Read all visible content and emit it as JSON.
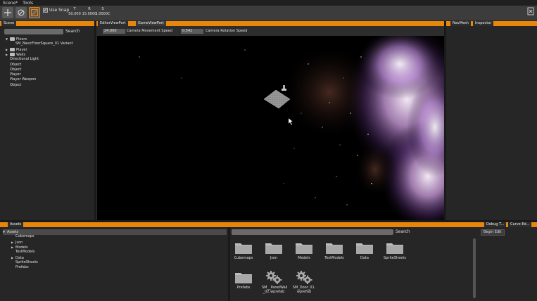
{
  "menu": {
    "items": [
      "Scene*",
      "Tools"
    ]
  },
  "toolbar": {
    "use_snap_label": "Use Snap",
    "snap_checked": true,
    "snap_columns": [
      {
        "header": "T",
        "value": "50.000"
      },
      {
        "header": "R",
        "value": "15.0000"
      },
      {
        "header": "S",
        "value": "1.0000C"
      }
    ],
    "buttons": [
      {
        "icon": "move-icon",
        "active": false
      },
      {
        "icon": "rotate-icon",
        "active": false
      },
      {
        "icon": "scale-icon",
        "active": true
      }
    ]
  },
  "scene_panel": {
    "tab": "Scene",
    "search_label": "Search",
    "tree": [
      {
        "label": "Floors",
        "depth": 0,
        "expanded": true,
        "folder": true
      },
      {
        "label": "SM_BasicFloorSquare_01 Variant",
        "depth": 1,
        "expanded": null,
        "folder": false
      },
      {
        "label": "Player",
        "depth": 0,
        "expanded": false,
        "folder": true
      },
      {
        "label": "Walls",
        "depth": 0,
        "expanded": false,
        "folder": true
      },
      {
        "label": "Directional Light",
        "depth": 0,
        "expanded": null,
        "folder": false
      },
      {
        "label": "Object",
        "depth": 0,
        "expanded": null,
        "folder": false
      },
      {
        "label": "Object",
        "depth": 0,
        "expanded": null,
        "folder": false
      },
      {
        "label": "Player",
        "depth": 0,
        "expanded": null,
        "folder": false
      },
      {
        "label": "Player Weapon",
        "depth": 0,
        "expanded": null,
        "folder": false
      },
      {
        "label": "Object",
        "depth": 0,
        "expanded": null,
        "folder": false
      }
    ]
  },
  "viewport": {
    "tabs": [
      "EditorViewPort",
      "GameViewPort"
    ],
    "camera_move_speed": "24.000",
    "camera_move_label": "Camera Movement Speed",
    "camera_rot_speed": "0.542",
    "camera_rot_label": "Camera Rotation Speed"
  },
  "right_panel": {
    "tabs": [
      "NavMesh",
      "Inspector"
    ]
  },
  "assets_panel": {
    "tab": "Assets",
    "search_label": "Search",
    "tree": [
      {
        "label": "Assets",
        "depth": 0,
        "expanded": true,
        "selected": true
      },
      {
        "label": "Cubemaps",
        "depth": 1,
        "expanded": null
      },
      {
        "label": "Json",
        "depth": 1,
        "expanded": false
      },
      {
        "label": "Models",
        "depth": 1,
        "expanded": false
      },
      {
        "label": "TestModels",
        "depth": 1,
        "expanded": null
      },
      {
        "label": "Data",
        "depth": 1,
        "expanded": false
      },
      {
        "label": "SpriteSheets",
        "depth": 1,
        "expanded": null
      },
      {
        "label": "Prefabs",
        "depth": 1,
        "expanded": null
      }
    ],
    "grid": [
      {
        "label": "Cubemaps",
        "kind": "folder"
      },
      {
        "label": "Json",
        "kind": "folder"
      },
      {
        "label": "Models",
        "kind": "folder"
      },
      {
        "label": "TestModels",
        "kind": "folder"
      },
      {
        "label": "Data",
        "kind": "folder"
      },
      {
        "label": "SpriteSheets",
        "kind": "folder"
      },
      {
        "label": "Prefabs",
        "kind": "folder"
      },
      {
        "label": "SM__PanelWall\n_02.wprefab",
        "kind": "prefab"
      },
      {
        "label": "SM_Door_01.\nwprefab",
        "kind": "prefab"
      }
    ]
  },
  "debug_panel": {
    "tabs": [
      "Debug T...",
      "Curve Ed..."
    ],
    "begin_edit_label": "Begin Edit"
  },
  "colors": {
    "accent": "#e8860c",
    "panel": "#262626",
    "toolbar": "#3c3c3c"
  }
}
